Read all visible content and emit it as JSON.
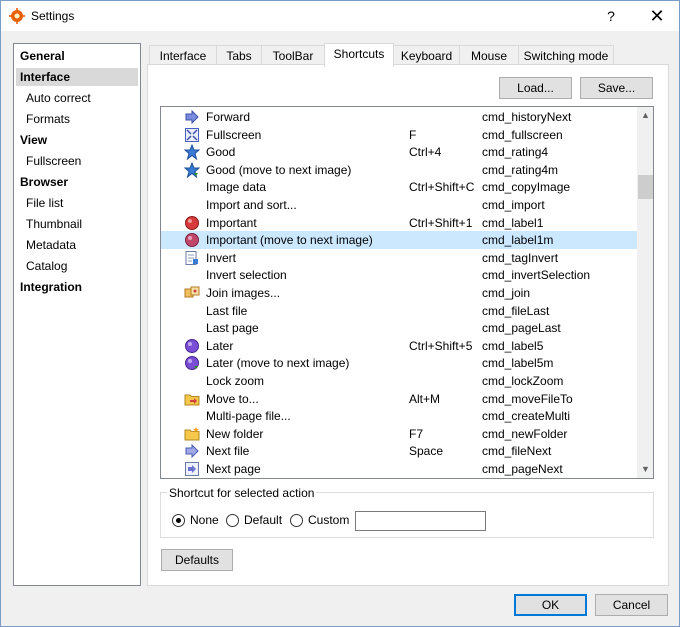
{
  "window": {
    "title": "Settings",
    "help_label": "?",
    "close_label": "✕"
  },
  "nav": {
    "items": [
      {
        "label": "General",
        "kind": "group"
      },
      {
        "label": "Interface",
        "kind": "group",
        "selected": true
      },
      {
        "label": "Auto correct",
        "kind": "sub"
      },
      {
        "label": "Formats",
        "kind": "sub"
      },
      {
        "label": "View",
        "kind": "group"
      },
      {
        "label": "Fullscreen",
        "kind": "sub"
      },
      {
        "label": "Browser",
        "kind": "group"
      },
      {
        "label": "File list",
        "kind": "sub"
      },
      {
        "label": "Thumbnail",
        "kind": "sub"
      },
      {
        "label": "Metadata",
        "kind": "sub"
      },
      {
        "label": "Catalog",
        "kind": "sub"
      },
      {
        "label": "Integration",
        "kind": "group"
      }
    ]
  },
  "tabs": [
    {
      "label": "Interface"
    },
    {
      "label": "Tabs"
    },
    {
      "label": "ToolBar"
    },
    {
      "label": "Shortcuts",
      "active": true
    },
    {
      "label": "Keyboard"
    },
    {
      "label": "Mouse"
    },
    {
      "label": "Switching mode"
    }
  ],
  "buttons": {
    "load": "Load...",
    "save": "Save...",
    "defaults": "Defaults",
    "ok": "OK",
    "cancel": "Cancel"
  },
  "shortcuts": {
    "rows": [
      {
        "name": "Forward",
        "key": "",
        "command": "cmd_historyNext",
        "icon": "forward-arrow-icon"
      },
      {
        "name": "Fullscreen",
        "key": "F",
        "command": "cmd_fullscreen",
        "icon": "fullscreen-icon"
      },
      {
        "name": "Good",
        "key": "Ctrl+4",
        "command": "cmd_rating4",
        "icon": "star-icon"
      },
      {
        "name": "Good (move to next image)",
        "key": "",
        "command": "cmd_rating4m",
        "icon": "star-next-icon"
      },
      {
        "name": "Image data",
        "key": "Ctrl+Shift+C",
        "command": "cmd_copyImage",
        "icon": ""
      },
      {
        "name": "Import and sort...",
        "key": "",
        "command": "cmd_import",
        "icon": ""
      },
      {
        "name": "Important",
        "key": "Ctrl+Shift+1",
        "command": "cmd_label1",
        "icon": "red-label-icon"
      },
      {
        "name": "Important (move to next image)",
        "key": "",
        "command": "cmd_label1m",
        "icon": "red-label-next-icon",
        "highlight": true
      },
      {
        "name": "Invert",
        "key": "",
        "command": "cmd_tagInvert",
        "icon": "invert-icon"
      },
      {
        "name": "Invert selection",
        "key": "",
        "command": "cmd_invertSelection",
        "icon": ""
      },
      {
        "name": "Join images...",
        "key": "",
        "command": "cmd_join",
        "icon": "join-images-icon"
      },
      {
        "name": "Last file",
        "key": "",
        "command": "cmd_fileLast",
        "icon": ""
      },
      {
        "name": "Last page",
        "key": "",
        "command": "cmd_pageLast",
        "icon": ""
      },
      {
        "name": "Later",
        "key": "Ctrl+Shift+5",
        "command": "cmd_label5",
        "icon": "purple-label-icon"
      },
      {
        "name": "Later (move to next image)",
        "key": "",
        "command": "cmd_label5m",
        "icon": "purple-label-next-icon"
      },
      {
        "name": "Lock zoom",
        "key": "",
        "command": "cmd_lockZoom",
        "icon": ""
      },
      {
        "name": "Move to...",
        "key": "Alt+M",
        "command": "cmd_moveFileTo",
        "icon": "move-to-folder-icon"
      },
      {
        "name": "Multi-page file...",
        "key": "",
        "command": "cmd_createMulti",
        "icon": ""
      },
      {
        "name": "New folder",
        "key": "F7",
        "command": "cmd_newFolder",
        "icon": "new-folder-icon"
      },
      {
        "name": "Next file",
        "key": "Space",
        "command": "cmd_fileNext",
        "icon": "next-file-icon"
      },
      {
        "name": "Next page",
        "key": "",
        "command": "cmd_pageNext",
        "icon": "next-page-icon"
      }
    ]
  },
  "shortcut_group": {
    "title": "Shortcut for selected action",
    "options": [
      {
        "label": "None",
        "checked": true
      },
      {
        "label": "Default",
        "checked": false
      },
      {
        "label": "Custom",
        "checked": false
      }
    ],
    "custom_value": ""
  },
  "colors": {
    "accent": "#0078d7",
    "selection": "#cce8ff",
    "nav_selected": "#d9d9d9"
  }
}
